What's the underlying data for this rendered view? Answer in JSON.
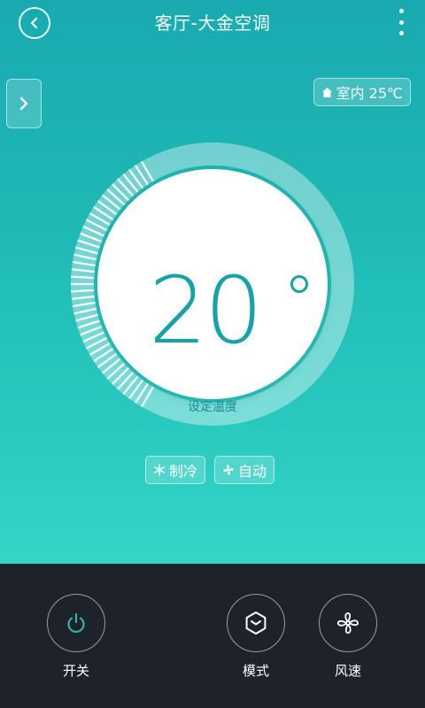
{
  "header": {
    "title": "客厅-大金空调"
  },
  "indoor": {
    "label": "室内 25℃"
  },
  "dial": {
    "temperature": "20",
    "set_label": "设定温度"
  },
  "chips": [
    {
      "label": "制冷",
      "icon": "snowflake-icon"
    },
    {
      "label": "自动",
      "icon": "fan-icon"
    }
  ],
  "controls": [
    {
      "label": "开关",
      "icon": "power-icon"
    },
    {
      "label": "模式",
      "icon": "mode-hexagon-icon"
    },
    {
      "label": "风速",
      "icon": "fan-speed-icon"
    }
  ],
  "colors": {
    "accent": "#16a2a6",
    "background_top": "#18aab0",
    "background_bottom": "#34d5c7",
    "bottom_bar": "#1d222b"
  }
}
